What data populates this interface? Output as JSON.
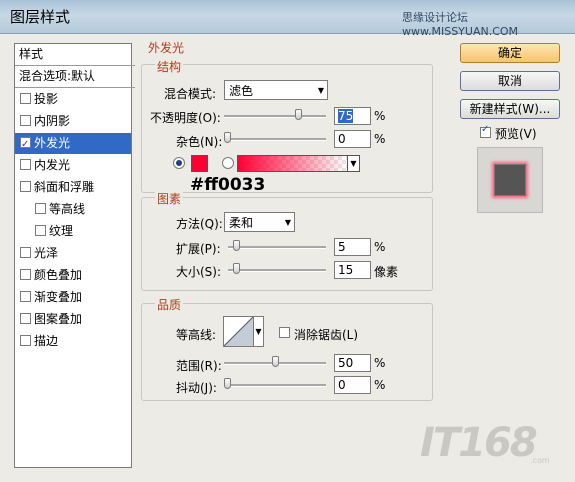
{
  "window": {
    "title": "图层样式",
    "watermark": "思缘设计论坛 www.MISSYUAN.COM"
  },
  "styles_list": {
    "header": "样式",
    "blend_options": "混合选项:默认",
    "items": [
      {
        "label": "投影",
        "checked": false
      },
      {
        "label": "内阴影",
        "checked": false
      },
      {
        "label": "外发光",
        "checked": true,
        "selected": true
      },
      {
        "label": "内发光",
        "checked": false
      },
      {
        "label": "斜面和浮雕",
        "checked": false
      },
      {
        "label": "等高线",
        "checked": false,
        "sub": true
      },
      {
        "label": "纹理",
        "checked": false,
        "sub": true
      },
      {
        "label": "光泽",
        "checked": false
      },
      {
        "label": "颜色叠加",
        "checked": false
      },
      {
        "label": "渐变叠加",
        "checked": false
      },
      {
        "label": "图案叠加",
        "checked": false
      },
      {
        "label": "描边",
        "checked": false
      }
    ]
  },
  "section": {
    "title": "外发光"
  },
  "structure": {
    "title": "结构",
    "blend_mode_label": "混合模式:",
    "blend_mode_value": "滤色",
    "opacity_label": "不透明度(O):",
    "opacity_value": "75",
    "opacity_pct": 75,
    "noise_label": "杂色(N):",
    "noise_value": "0",
    "noise_pct": 0,
    "unit_percent": "%",
    "color_hex_annotation": "#ff0033",
    "glow_color": "#ff0033"
  },
  "elements": {
    "title": "图素",
    "method_label": "方法(Q):",
    "method_value": "柔和",
    "spread_label": "扩展(P):",
    "spread_value": "5",
    "spread_pct": 5,
    "size_label": "大小(S):",
    "size_value": "15",
    "size_pct": 6,
    "unit_percent": "%",
    "unit_pixels": "像素"
  },
  "quality": {
    "title": "品质",
    "contour_label": "等高线:",
    "antialias_label": "消除锯齿(L)",
    "range_label": "范围(R):",
    "range_value": "50",
    "range_pct": 50,
    "jitter_label": "抖动(J):",
    "jitter_value": "0",
    "jitter_pct": 0,
    "unit_percent": "%"
  },
  "buttons": {
    "ok": "确定",
    "cancel": "取消",
    "new_style": "新建样式(W)...",
    "preview": "预览(V)"
  },
  "logo": {
    "text": "IT168",
    "sub": ".com"
  }
}
